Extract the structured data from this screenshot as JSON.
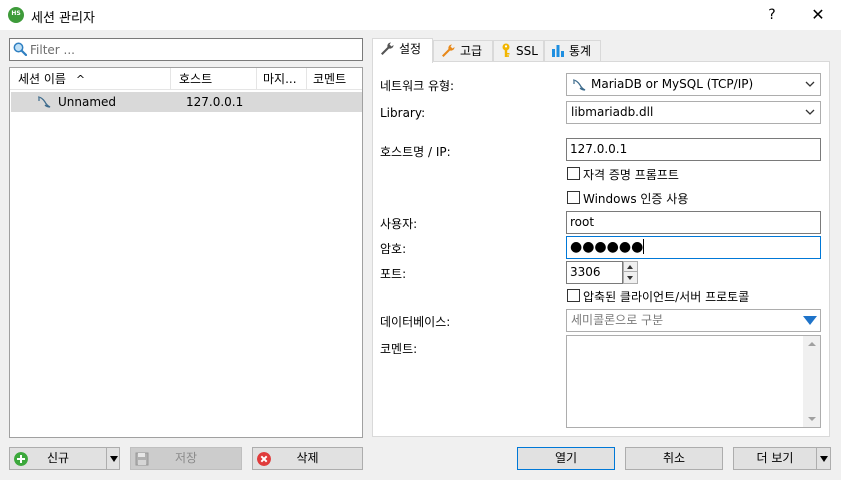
{
  "window": {
    "title": "세션 관리자",
    "help": "?",
    "close": "✕",
    "app_icon_text": "HS"
  },
  "filter": {
    "placeholder": "Filter ..."
  },
  "session_tree": {
    "columns": [
      "세션 이름",
      "호스트",
      "마지...",
      "코멘트"
    ],
    "sort_indicator": "^",
    "rows": [
      {
        "name": "Unnamed",
        "host": "127.0.0.1",
        "last": "",
        "comment": ""
      }
    ]
  },
  "left_buttons": {
    "new": "신규",
    "save": "저장",
    "delete": "삭제"
  },
  "tabs": [
    {
      "label": "설정",
      "icon": "wrench-icon"
    },
    {
      "label": "고급",
      "icon": "wrench-orange-icon"
    },
    {
      "label": "SSL",
      "icon": "key-icon"
    },
    {
      "label": "통계",
      "icon": "bar-chart-icon"
    }
  ],
  "settings": {
    "network_type_label": "네트워크 유형:",
    "network_type_value": "MariaDB or MySQL (TCP/IP)",
    "library_label": "Library:",
    "library_value": "libmariadb.dll",
    "host_label": "호스트명 / IP:",
    "host_value": "127.0.0.1",
    "prompt_credentials_label": "자격 증명 프롬프트",
    "windows_auth_label": "Windows 인증 사용",
    "user_label": "사용자:",
    "user_value": "root",
    "password_label": "암호:",
    "password_value": "●●●●●●",
    "port_label": "포트:",
    "port_value": "3306",
    "compressed_label": "압축된 클라이언트/서버 프로토콜",
    "databases_label": "데이터베이스:",
    "databases_placeholder": "세미콜론으로 구분",
    "comment_label": "코멘트:"
  },
  "bottom_buttons": {
    "open": "열기",
    "cancel": "취소",
    "more": "더 보기"
  },
  "colors": {
    "accent": "#0078d7",
    "selected_row": "#d9d9d9",
    "new_icon": "#3ca83c",
    "delete_icon": "#e03b3b"
  }
}
